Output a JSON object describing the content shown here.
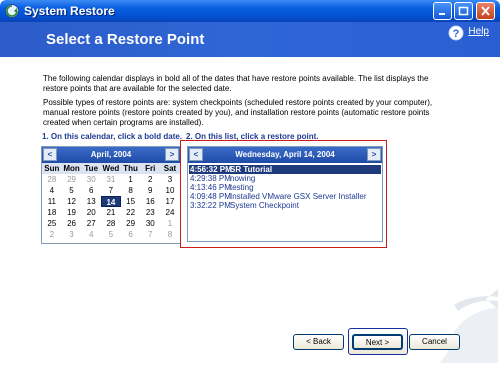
{
  "window": {
    "title": "System Restore",
    "icon": "system-restore-icon"
  },
  "header": {
    "heading": "Select a Restore Point",
    "help_label": "Help",
    "help_icon": "help-icon"
  },
  "intro": {
    "line1": "The following calendar displays in bold all of the dates that have restore points available. The list displays the restore points that are available for the selected date.",
    "line2": "Possible types of restore points are: system checkpoints (scheduled restore points created by your computer), manual restore points (restore points created by you), and installation restore points (automatic restore points created when certain programs are installed)."
  },
  "step1": "1. On this calendar, click a bold date.",
  "step2": "2. On this list, click a restore point.",
  "calendar": {
    "month": "April, 2004",
    "prev": "<",
    "next": ">",
    "days_of_week": [
      "Sun",
      "Mon",
      "Tue",
      "Wed",
      "Thu",
      "Fri",
      "Sat"
    ],
    "weeks": [
      [
        "28",
        "29",
        "30",
        "31",
        "1",
        "2",
        "3"
      ],
      [
        "4",
        "5",
        "6",
        "7",
        "8",
        "9",
        "10"
      ],
      [
        "11",
        "12",
        "13",
        "14",
        "15",
        "16",
        "17"
      ],
      [
        "18",
        "19",
        "20",
        "21",
        "22",
        "23",
        "24"
      ],
      [
        "25",
        "26",
        "27",
        "28",
        "29",
        "30",
        "1"
      ],
      [
        "2",
        "3",
        "4",
        "5",
        "6",
        "7",
        "8"
      ]
    ],
    "selected": "14"
  },
  "restore_list": {
    "date": "Wednesday, April 14, 2004",
    "prev": "<",
    "next": ">",
    "items": [
      {
        "time": "4:56:32 PM",
        "name": "SR Tutorial"
      },
      {
        "time": "4:29:38 PM",
        "name": "nowing"
      },
      {
        "time": "4:13:46 PM",
        "name": "testing"
      },
      {
        "time": "4:09:48 PM",
        "name": "Installed VMware GSX Server Installer"
      },
      {
        "time": "3:32:22 PM",
        "name": "System Checkpoint"
      }
    ]
  },
  "buttons": {
    "back": "< Back",
    "next": "Next >",
    "cancel": "Cancel"
  },
  "colors": {
    "accent": "#2f66d6",
    "highlight": "#cc1b1b",
    "selection": "#1f3a7a"
  }
}
